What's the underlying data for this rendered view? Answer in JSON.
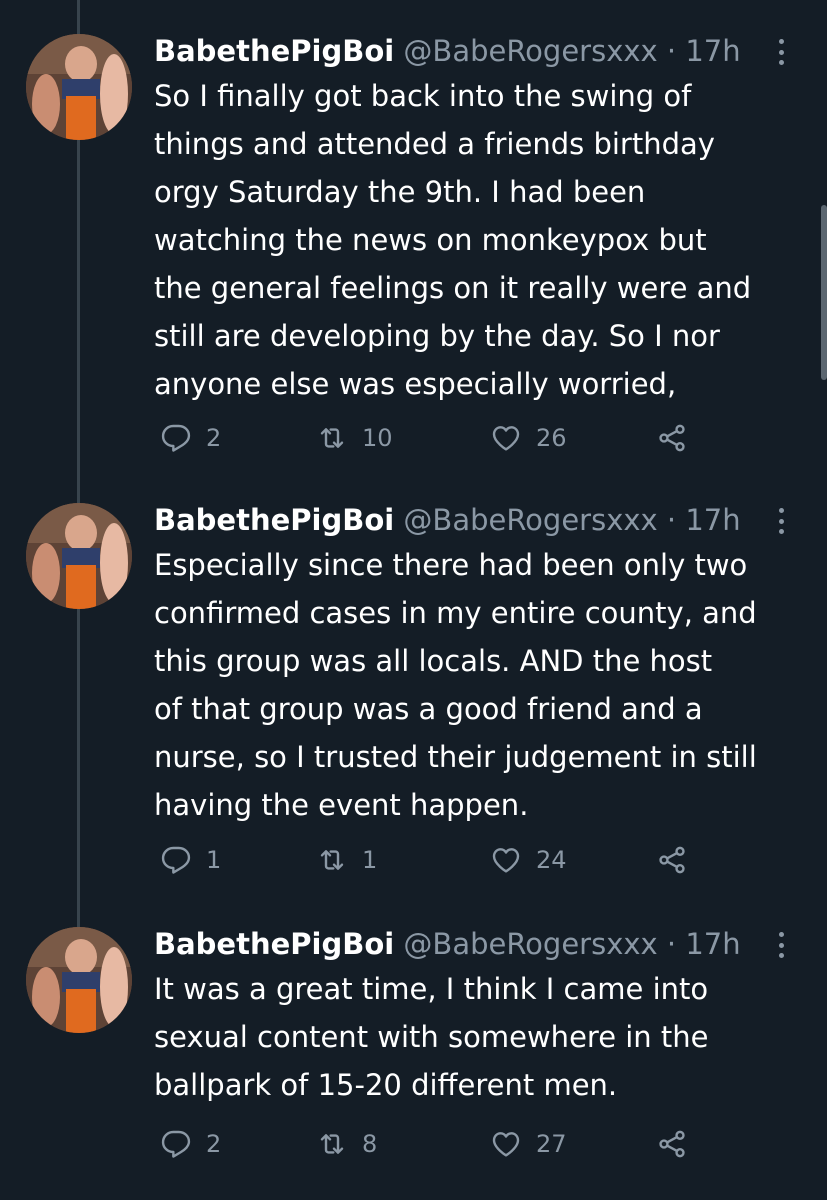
{
  "tweets": [
    {
      "name": "BabethePigBoi",
      "handle": "@BabeRogersxxx",
      "dot": "·",
      "time": "17h",
      "text": "So I finally got back into the swing of\nthings and attended a friends birthday\norgy Saturday the 9th. I had been\nwatching the news on monkeypox but\nthe general feelings on it really were and\nstill are developing by the day. So I nor\nanyone else was especially worried,",
      "replies": "2",
      "retweets": "10",
      "likes": "26"
    },
    {
      "name": "BabethePigBoi",
      "handle": "@BabeRogersxxx",
      "dot": "·",
      "time": "17h",
      "text": "Especially since there had been only two\nconfirmed cases in my entire county, and\nthis group was all locals. AND the host\nof that group was a good friend and a\nnurse, so I trusted their judgement in still\nhaving the event happen.",
      "replies": "1",
      "retweets": "1",
      "likes": "24"
    },
    {
      "name": "BabethePigBoi",
      "handle": "@BabeRogersxxx",
      "dot": "·",
      "time": "17h",
      "text": "It was a great time, I think I came into\nsexual content with somewhere in the\nballpark of 15-20 different men.",
      "replies": "2",
      "retweets": "8",
      "likes": "27"
    }
  ],
  "icons": {
    "reply": "reply-icon",
    "retweet": "retweet-icon",
    "like": "heart-icon",
    "share": "share-icon",
    "more": "more-options-icon"
  },
  "colors": {
    "background": "#141d26",
    "secondary_text": "#8b98a5",
    "thread_line": "#38444d"
  }
}
